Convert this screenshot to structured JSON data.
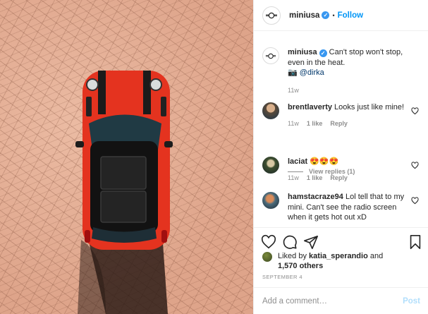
{
  "post": {
    "username": "miniusa",
    "verified_icon": "verified-badge-icon",
    "dot": "•",
    "follow_label": "Follow"
  },
  "caption": {
    "username": "miniusa",
    "text": "Can't stop won't stop, even in the heat.",
    "camera_icon": "📷",
    "mention": "@dirka",
    "time": "11w"
  },
  "comments": [
    {
      "username": "brentlaverty",
      "text": "Looks just like mine!",
      "time": "11w",
      "likes": "1 like",
      "reply": "Reply"
    },
    {
      "username": "laciat",
      "text": "😍😍😍",
      "time": "11w",
      "likes": "1 like",
      "reply": "Reply"
    },
    {
      "username": "hamstacraze94",
      "text": "Lol tell that to my mini. Can't see the radio screen when it gets hot out xD"
    }
  ],
  "view_replies": "View replies (1)",
  "liked_by": {
    "prefix": "Liked by",
    "user": "katia_sperandio",
    "and": "and",
    "others": "1,570 others"
  },
  "date": "SEPTEMBER 4",
  "add_comment": {
    "placeholder": "Add a comment…",
    "post_label": "Post"
  },
  "colors": {
    "accent": "#0095f6",
    "post_disabled": "#b2dffc",
    "car_red": "#e4331f",
    "ground": "#e6b096"
  }
}
